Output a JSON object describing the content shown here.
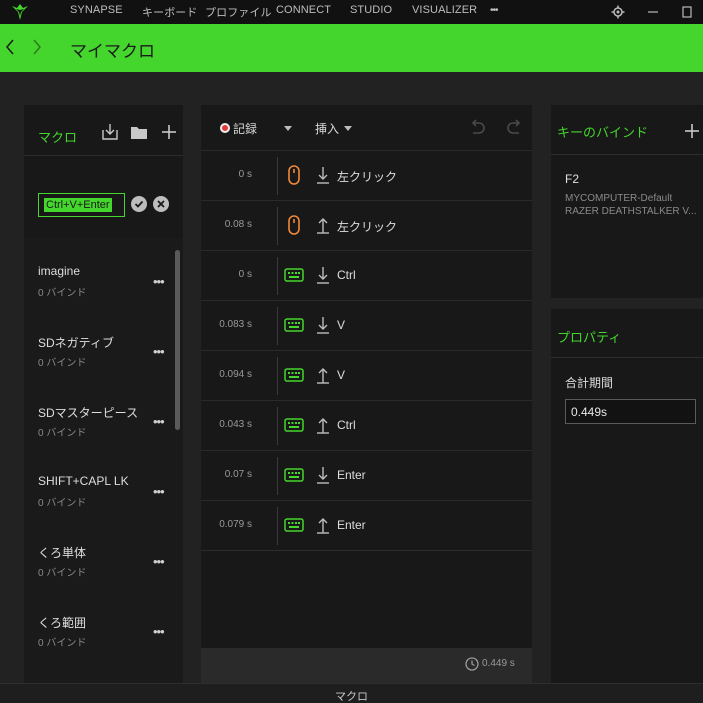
{
  "nav": {
    "items": [
      "SYNAPSE",
      "キーボード",
      "プロファイル",
      "CONNECT",
      "STUDIO",
      "VISUALIZER"
    ],
    "more": "•••"
  },
  "header": {
    "title": "マイマクロ"
  },
  "macro_panel": {
    "title": "マクロ",
    "edit_value": "Ctrl+V+Enter",
    "items": [
      {
        "name": "imagine",
        "sub": "0 バインド"
      },
      {
        "name": "SDネガティブ",
        "sub": "0 バインド"
      },
      {
        "name": "SDマスターピース",
        "sub": "0 バインド"
      },
      {
        "name": "SHIFT+CAPL LK",
        "sub": "0 バインド"
      },
      {
        "name": "くろ単体",
        "sub": "0 バインド"
      },
      {
        "name": "くろ範囲",
        "sub": "0 バインド"
      }
    ],
    "item_menu": "•••"
  },
  "editor": {
    "record_label": "記録",
    "insert_label": "挿入",
    "events": [
      {
        "time": "0 s",
        "device": "mouse",
        "direction": "down",
        "label": "左クリック"
      },
      {
        "time": "0.08 s",
        "device": "mouse",
        "direction": "up",
        "label": "左クリック"
      },
      {
        "time": "0 s",
        "device": "keyboard",
        "direction": "down",
        "label": "Ctrl"
      },
      {
        "time": "0.083 s",
        "device": "keyboard",
        "direction": "down",
        "label": "V"
      },
      {
        "time": "0.094 s",
        "device": "keyboard",
        "direction": "up",
        "label": "V"
      },
      {
        "time": "0.043 s",
        "device": "keyboard",
        "direction": "up",
        "label": "Ctrl"
      },
      {
        "time": "0.07 s",
        "device": "keyboard",
        "direction": "down",
        "label": "Enter"
      },
      {
        "time": "0.079 s",
        "device": "keyboard",
        "direction": "up",
        "label": "Enter"
      }
    ],
    "total_time": "0.449 s"
  },
  "keybind_panel": {
    "title": "キーのバインド",
    "key": "F2",
    "line1": "MYCOMPUTER-Default",
    "line2": "RAZER DEATHSTALKER V..."
  },
  "prop_panel": {
    "title": "プロパティ",
    "label": "合計期間",
    "value": "0.449s"
  },
  "bottom": {
    "label": "マクロ"
  },
  "colors": {
    "accent": "#44d62c",
    "mouse_icon": "#f0883a",
    "record": "#e53935"
  }
}
